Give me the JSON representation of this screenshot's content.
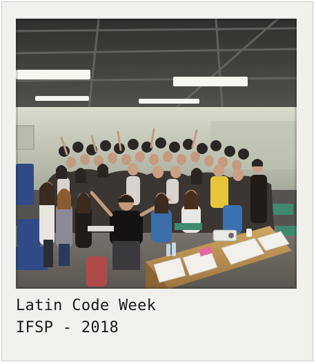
{
  "caption": {
    "line1": "Latin Code Week",
    "line2": "IFSP - 2018"
  },
  "photo": {
    "subject": "group-photo-classroom",
    "colors": {
      "ceiling": "#3f3f3d",
      "wall": "#c9cdbd",
      "floor": "#6d6a64",
      "desk": "#c59a5a",
      "paper": "#f0eee9",
      "light": "#f5f5ee"
    }
  }
}
